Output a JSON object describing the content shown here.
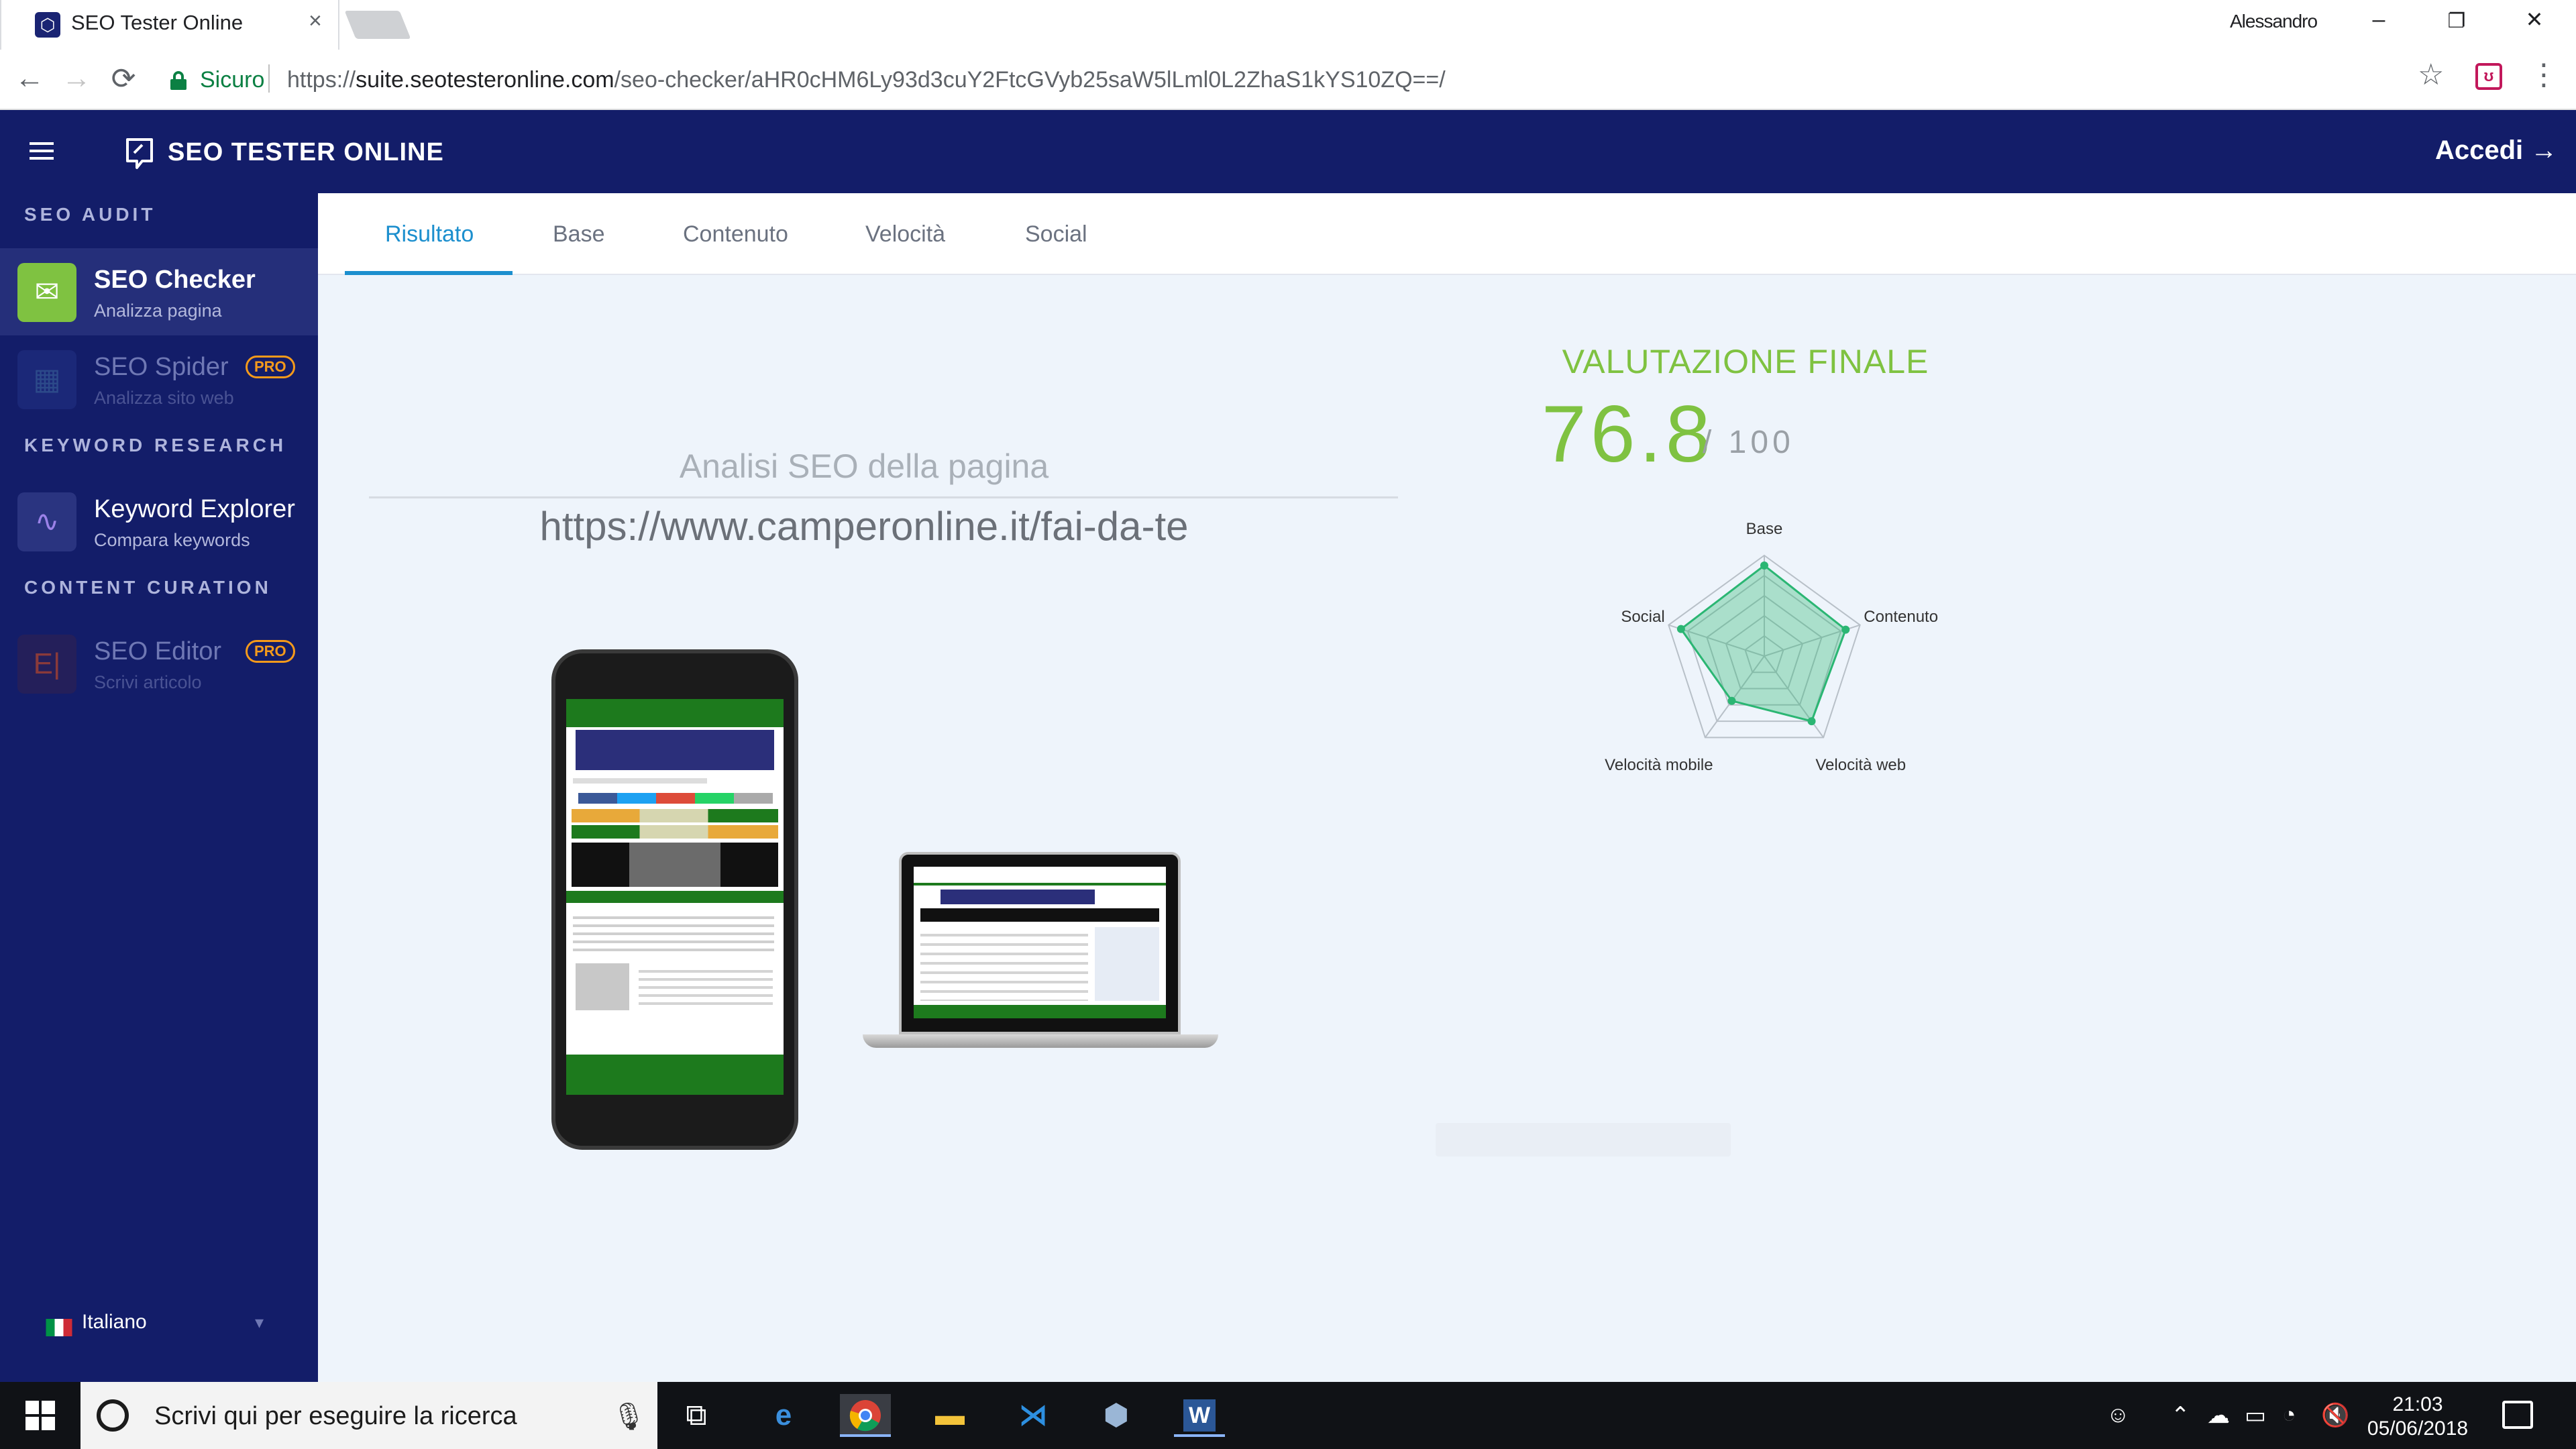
{
  "browser": {
    "tab_title": "SEO Tester Online",
    "tab_close": "×",
    "profile_name": "Alessandro",
    "window_controls": {
      "minimize": "–",
      "restore": "❐",
      "close": "✕"
    },
    "back_icon": "←",
    "forward_icon": "→",
    "reload_icon": "⟳",
    "secure_label": "Sicuro",
    "url_scheme": "https://",
    "url_host": "suite.seotesteronline.com",
    "url_path": "/seo-checker/aHR0cHM6Ly93d3cuY2FtcGVyb25saW5lLml0L2ZhaS1kYS10ZQ==/",
    "bookmark_icon": "☆",
    "menu_icon": "⋮",
    "extension_icon": "ublock-icon"
  },
  "header": {
    "logo_text": "SEO TESTER ONLINE",
    "login_label": "Accedi →",
    "brand_color": "#131d69"
  },
  "sidebar": {
    "sections": [
      {
        "title": "SEO AUDIT",
        "items": [
          {
            "label": "SEO Checker",
            "sub": "Analizza pagina",
            "active": true,
            "icon": "checker-icon"
          },
          {
            "label": "SEO Spider",
            "sub": "Analizza sito web",
            "badge": "PRO",
            "icon": "spider-icon"
          }
        ]
      },
      {
        "title": "KEYWORD RESEARCH",
        "items": [
          {
            "label": "Keyword Explorer",
            "sub": "Compara keywords",
            "icon": "keyword-icon"
          }
        ]
      },
      {
        "title": "CONTENT CURATION",
        "items": [
          {
            "label": "SEO Editor",
            "sub": "Scrivi articolo",
            "badge": "PRO",
            "icon": "editor-icon"
          }
        ]
      }
    ],
    "language": "Italiano"
  },
  "main": {
    "tabs": [
      {
        "label": "Risultato",
        "active": true
      },
      {
        "label": "Base"
      },
      {
        "label": "Contenuto"
      },
      {
        "label": "Velocità"
      },
      {
        "label": "Social"
      }
    ],
    "analysis_label": "Analisi SEO della pagina",
    "analysis_url": "https://www.camperonline.it/fai-da-te",
    "score_title": "VALUTAZIONE FINALE",
    "score_value": "76.8",
    "score_max": "/ 100",
    "score_color": "#7fc241"
  },
  "chart_data": {
    "type": "radar",
    "axes": [
      "Base",
      "Contenuto",
      "Velocità web",
      "Velocità mobile",
      "Social"
    ],
    "values": [
      90,
      85,
      80,
      55,
      87
    ],
    "max": 100,
    "grid_levels": 5,
    "fill_color": "#2bb673"
  },
  "taskbar": {
    "search_placeholder": "Scrivi qui per eseguire la ricerca",
    "time": "21:03",
    "date": "05/06/2018",
    "apps": [
      "task-view-icon",
      "edge-icon",
      "chrome-icon",
      "file-explorer-icon",
      "vscode-icon",
      "box-icon",
      "word-icon"
    ]
  }
}
